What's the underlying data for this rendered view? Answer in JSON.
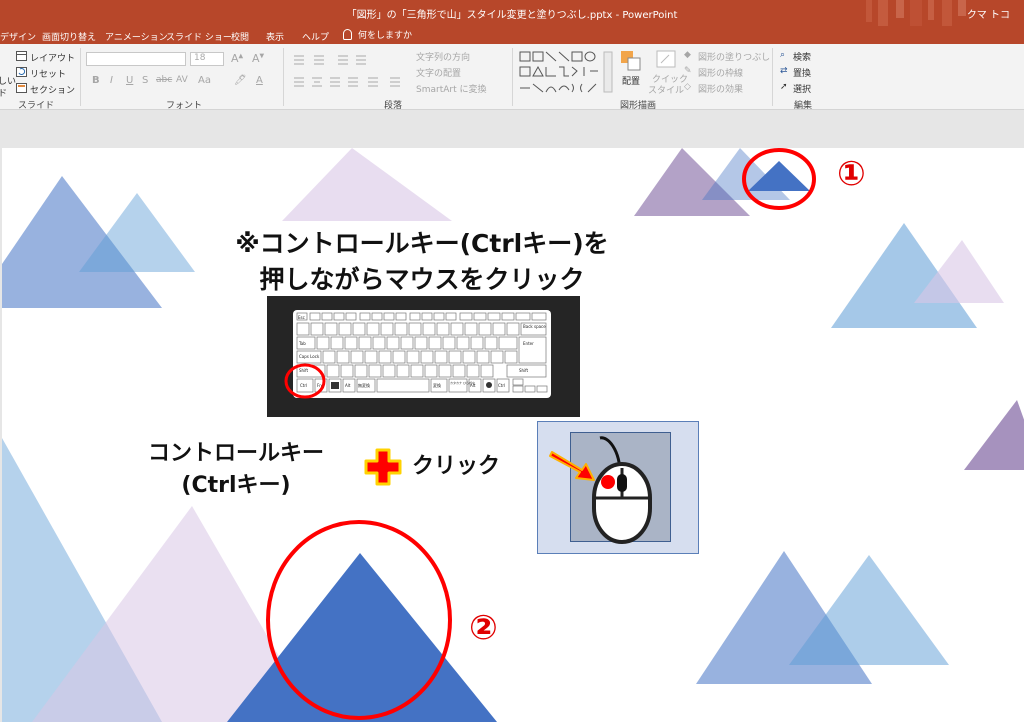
{
  "titlebar": {
    "title": "「図形」の「三角形で山」スタイル変更と塗りつぶし.pptx - PowerPoint",
    "user": "クマ トコ"
  },
  "tabs": [
    {
      "label": "デザイン"
    },
    {
      "label": "画面切り替え"
    },
    {
      "label": "アニメーション"
    },
    {
      "label": "スライド ショー"
    },
    {
      "label": "校閲"
    },
    {
      "label": "表示"
    },
    {
      "label": "ヘルプ"
    }
  ],
  "tell_me": "何をしますか",
  "ribbon": {
    "slides": {
      "layout": "レイアウト",
      "reset": "リセット",
      "section": "セクション",
      "new_slide_partial": "しい",
      "label": "スライド",
      "arrow_label": "ド"
    },
    "font": {
      "font_size": "18",
      "bold": "B",
      "italic": "I",
      "underline": "U",
      "strike": "S",
      "shadow": "abc",
      "spacing": "AV",
      "case": "Aa",
      "label": "フォント",
      "font_color": "A"
    },
    "paragraph": {
      "text_direction": "文字列の方向",
      "align_text": "文字の配置",
      "smartart": "SmartArt に変換",
      "label": "段落"
    },
    "drawing": {
      "arrange": "配置",
      "quick_style_1": "クイック",
      "quick_style_2": "スタイル",
      "fill": "図形の塗りつぶし",
      "outline": "図形の枠線",
      "effects": "図形の効果",
      "label": "図形描画"
    },
    "editing": {
      "find": "検索",
      "replace": "置換",
      "select": "選択",
      "label": "編集"
    }
  },
  "slide": {
    "heading_line1": "※コントロールキー(Ctrlキー)を",
    "heading_line2": "押しながらマウスをクリック",
    "combo_line1": "コントロールキー",
    "combo_line2": "(Ctrlキー)",
    "click_text": "クリック",
    "marker1": "①",
    "marker2": "②",
    "keyboard": {
      "esc": "Esc",
      "backspace": "Back space",
      "tab": "Tab",
      "enter": "Enter",
      "caps": "Caps Lock",
      "shift_l": "Shift",
      "shift_r": "Shift",
      "ctrl_l": "Ctrl",
      "alt_l": "Alt",
      "alt_r": "Alt",
      "ctrl_r": "Ctrl",
      "fn": "Fn",
      "muhenkan": "無変換",
      "henkan": "変換",
      "kana": "カタカナ ひらがな"
    }
  },
  "colors": {
    "accent": "#b7472a",
    "triangle_blue": "#4472c4",
    "circle_red": "#ff0000",
    "plus_red": "#ff0000",
    "plus_yellow": "#ffd200"
  }
}
